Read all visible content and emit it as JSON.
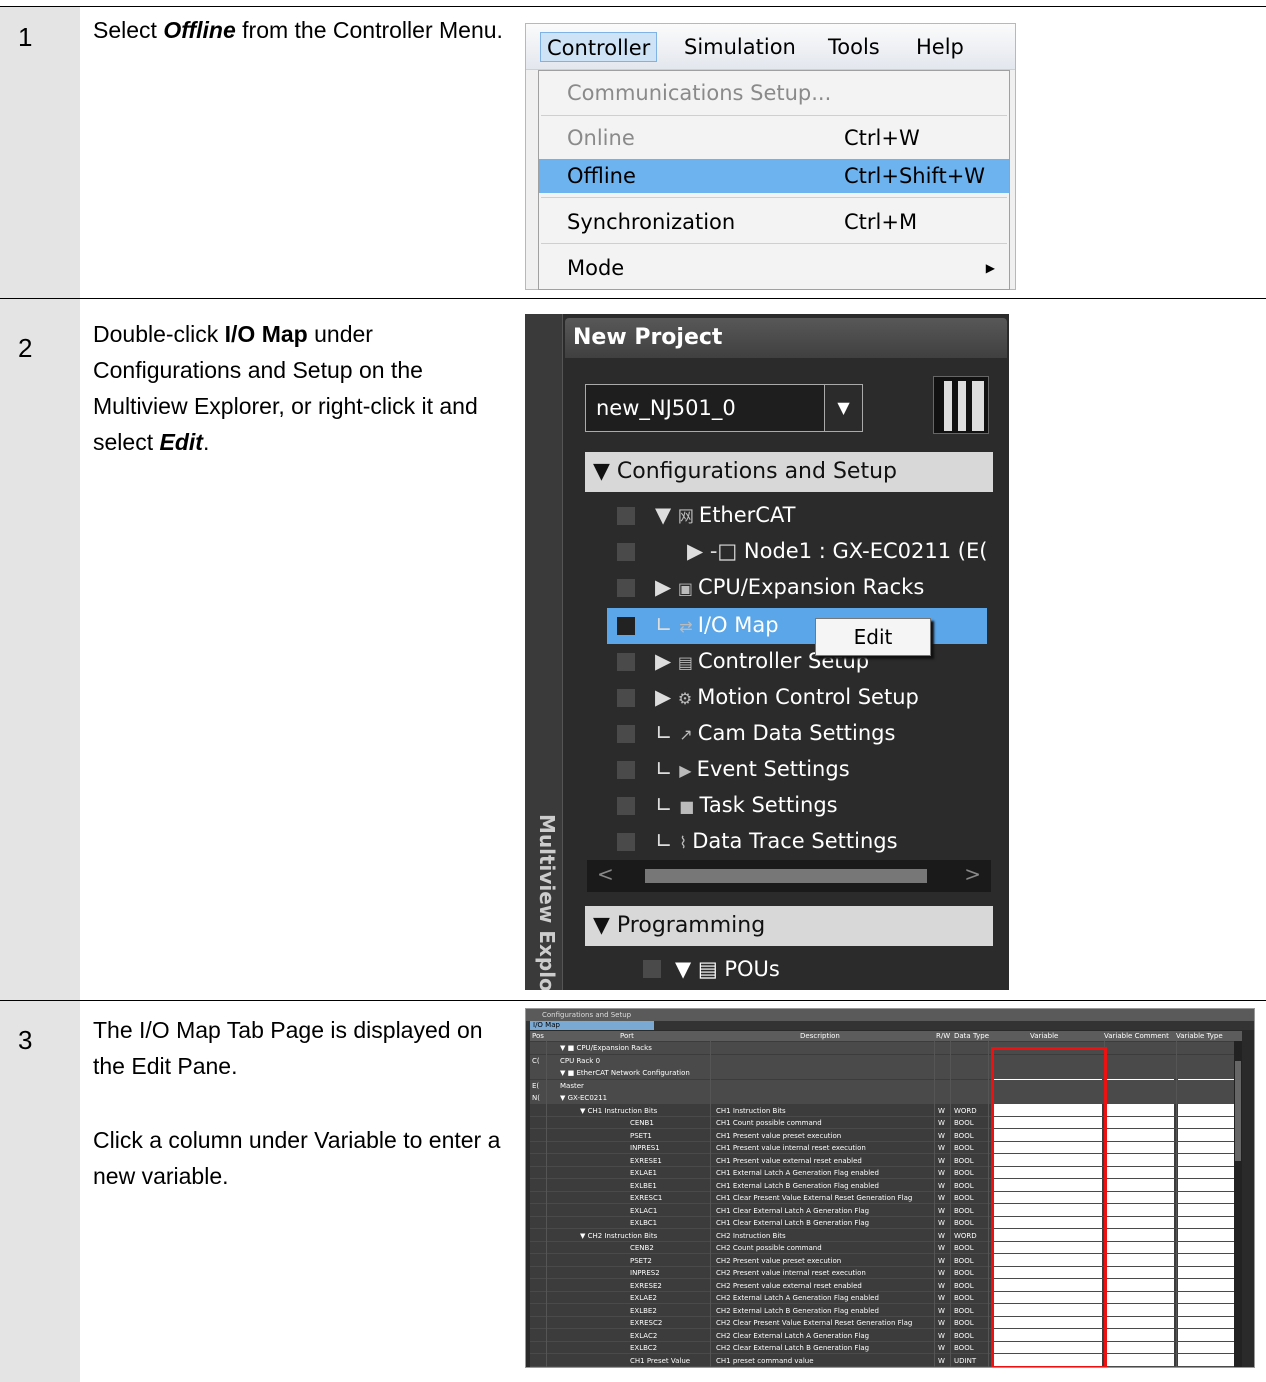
{
  "steps": [
    {
      "num": "1",
      "text": [
        {
          "t": "Select "
        },
        {
          "t": "Offline",
          "b": true,
          "i": true
        },
        {
          "t": " from the Controller Menu."
        }
      ]
    },
    {
      "num": "2",
      "text": [
        {
          "t": "Double-click "
        },
        {
          "t": "I/O Map",
          "b": true
        },
        {
          "t": " under Configurations and Setup on the Multiview Explorer, or right-click it and select "
        },
        {
          "t": "Edit",
          "b": true,
          "i": true
        },
        {
          "t": "."
        }
      ]
    },
    {
      "num": "3",
      "para1": "The I/O Map Tab Page is displayed on the Edit Pane.",
      "para2": "Click a column under Variable to enter a new variable."
    }
  ],
  "menu": {
    "bar": [
      "Controller",
      "Simulation",
      "Tools",
      "Help"
    ],
    "items": [
      {
        "label": "Communications Setup...",
        "shortcut": "",
        "state": "disabled"
      },
      {
        "label": "Online",
        "shortcut": "Ctrl+W",
        "state": "disabled"
      },
      {
        "label": "Offline",
        "shortcut": "Ctrl+Shift+W",
        "state": "selected"
      },
      {
        "label": "Synchronization",
        "shortcut": "Ctrl+M",
        "state": "normal"
      },
      {
        "label": "Mode",
        "shortcut": "",
        "state": "submenu"
      }
    ]
  },
  "explorer": {
    "title": "New Project",
    "device": "new_NJ501_0",
    "vertical_tab": "Multiview Explorer",
    "section1": "▼ Configurations and Setup",
    "nodes": [
      {
        "prefix": "▼ ",
        "icon": "网",
        "icon_name": "ethercat-icon",
        "label": "EtherCAT",
        "indent": 0
      },
      {
        "prefix": "▶ -□ ",
        "icon": "",
        "icon_name": "node-icon",
        "label": "Node1 : GX-EC0211 (E(",
        "indent": 1
      },
      {
        "prefix": "▶ ",
        "icon": "▣",
        "icon_name": "rack-icon",
        "label": "CPU/Expansion Racks",
        "indent": 0
      },
      {
        "prefix": "∟ ",
        "icon": "⇄",
        "icon_name": "io-map-icon",
        "label": "I/O Map",
        "indent": 0
      },
      {
        "prefix": "▶ ",
        "icon": "▤",
        "icon_name": "controller-setup-icon",
        "label": "Controller Setup",
        "indent": 0
      },
      {
        "prefix": "▶ ",
        "icon": "⚙",
        "icon_name": "gear-icon",
        "label": "Motion Control Setup",
        "indent": 0
      },
      {
        "prefix": "∟ ",
        "icon": "↗",
        "icon_name": "cam-icon",
        "label": "Cam Data Settings",
        "indent": 0
      },
      {
        "prefix": "∟ ",
        "icon": "▶",
        "icon_name": "flag-icon",
        "label": "Event Settings",
        "indent": 0
      },
      {
        "prefix": "∟ ",
        "icon": "■",
        "icon_name": "task-icon",
        "label": "Task Settings",
        "indent": 0
      },
      {
        "prefix": "∟ ",
        "icon": "⌇",
        "icon_name": "trace-icon",
        "label": "Data Trace Settings",
        "indent": 0
      }
    ],
    "context_menu": "Edit",
    "section2": "▼ Programming",
    "pous": "▼ ▤ POUs"
  },
  "iomap": {
    "window_title": "Configurations and Setup",
    "tab": "I/O Map",
    "columns": [
      "Pos",
      "Port",
      "Description",
      "R/W",
      "Data Type",
      "Variable",
      "Variable Comment",
      "Variable Type"
    ],
    "rows": [
      {
        "pos": "",
        "port": "▼ ■ CPU/Expansion Racks",
        "desc": "",
        "rw": "",
        "type": "",
        "grp": true
      },
      {
        "pos": "C(",
        "port": "CPU Rack 0",
        "desc": "",
        "rw": "",
        "type": "",
        "grp": true
      },
      {
        "pos": "",
        "port": "▼ ■ EtherCAT Network Configuration",
        "desc": "",
        "rw": "",
        "type": "",
        "grp": true
      },
      {
        "pos": "E(",
        "port": "Master",
        "desc": "",
        "rw": "",
        "type": "",
        "grp": true
      },
      {
        "pos": "N(",
        "port": "▼ GX-EC0211",
        "desc": "",
        "rw": "",
        "type": "",
        "grp": true
      },
      {
        "pos": "",
        "port": "▼ CH1 Instruction Bits",
        "desc": "CH1 Instruction Bits",
        "rw": "W",
        "type": "WORD"
      },
      {
        "pos": "",
        "port": "CENB1",
        "desc": "CH1 Count possible command",
        "rw": "W",
        "type": "BOOL"
      },
      {
        "pos": "",
        "port": "PSET1",
        "desc": "CH1 Present value preset execution",
        "rw": "W",
        "type": "BOOL"
      },
      {
        "pos": "",
        "port": "INPRES1",
        "desc": "CH1 Present value internal reset execution",
        "rw": "W",
        "type": "BOOL"
      },
      {
        "pos": "",
        "port": "EXRESE1",
        "desc": "CH1 Present value external reset enabled",
        "rw": "W",
        "type": "BOOL"
      },
      {
        "pos": "",
        "port": "EXLAE1",
        "desc": "CH1 External Latch A Generation Flag enabled",
        "rw": "W",
        "type": "BOOL"
      },
      {
        "pos": "",
        "port": "EXLBE1",
        "desc": "CH1 External Latch B Generation Flag enabled",
        "rw": "W",
        "type": "BOOL"
      },
      {
        "pos": "",
        "port": "EXRESC1",
        "desc": "CH1 Clear Present Value External Reset Generation Flag",
        "rw": "W",
        "type": "BOOL"
      },
      {
        "pos": "",
        "port": "EXLAC1",
        "desc": "CH1 Clear External Latch A Generation Flag",
        "rw": "W",
        "type": "BOOL"
      },
      {
        "pos": "",
        "port": "EXLBC1",
        "desc": "CH1 Clear External Latch B Generation Flag",
        "rw": "W",
        "type": "BOOL"
      },
      {
        "pos": "",
        "port": "▼ CH2 Instruction Bits",
        "desc": "CH2 Instruction Bits",
        "rw": "W",
        "type": "WORD"
      },
      {
        "pos": "",
        "port": "CENB2",
        "desc": "CH2 Count possible command",
        "rw": "W",
        "type": "BOOL"
      },
      {
        "pos": "",
        "port": "PSET2",
        "desc": "CH2 Present value preset execution",
        "rw": "W",
        "type": "BOOL"
      },
      {
        "pos": "",
        "port": "INPRES2",
        "desc": "CH2 Present value internal reset execution",
        "rw": "W",
        "type": "BOOL"
      },
      {
        "pos": "",
        "port": "EXRESE2",
        "desc": "CH2 Present value external reset enabled",
        "rw": "W",
        "type": "BOOL"
      },
      {
        "pos": "",
        "port": "EXLAE2",
        "desc": "CH2 External Latch A Generation Flag enabled",
        "rw": "W",
        "type": "BOOL"
      },
      {
        "pos": "",
        "port": "EXLBE2",
        "desc": "CH2 External Latch B Generation Flag enabled",
        "rw": "W",
        "type": "BOOL"
      },
      {
        "pos": "",
        "port": "EXRESC2",
        "desc": "CH2 Clear Present Value External Reset Generation Flag",
        "rw": "W",
        "type": "BOOL"
      },
      {
        "pos": "",
        "port": "EXLAC2",
        "desc": "CH2 Clear External Latch A Generation Flag",
        "rw": "W",
        "type": "BOOL"
      },
      {
        "pos": "",
        "port": "EXLBC2",
        "desc": "CH2 Clear External Latch B Generation Flag",
        "rw": "W",
        "type": "BOOL"
      },
      {
        "pos": "",
        "port": "CH1 Preset Value",
        "desc": "CH1 preset command value",
        "rw": "W",
        "type": "UDINT"
      }
    ]
  },
  "colors": {
    "step_bg": "#e4e4e4",
    "menu_highlight": "#6cb3f0",
    "tree_highlight": "#5aa6e8",
    "red_box": "#ee1111"
  }
}
